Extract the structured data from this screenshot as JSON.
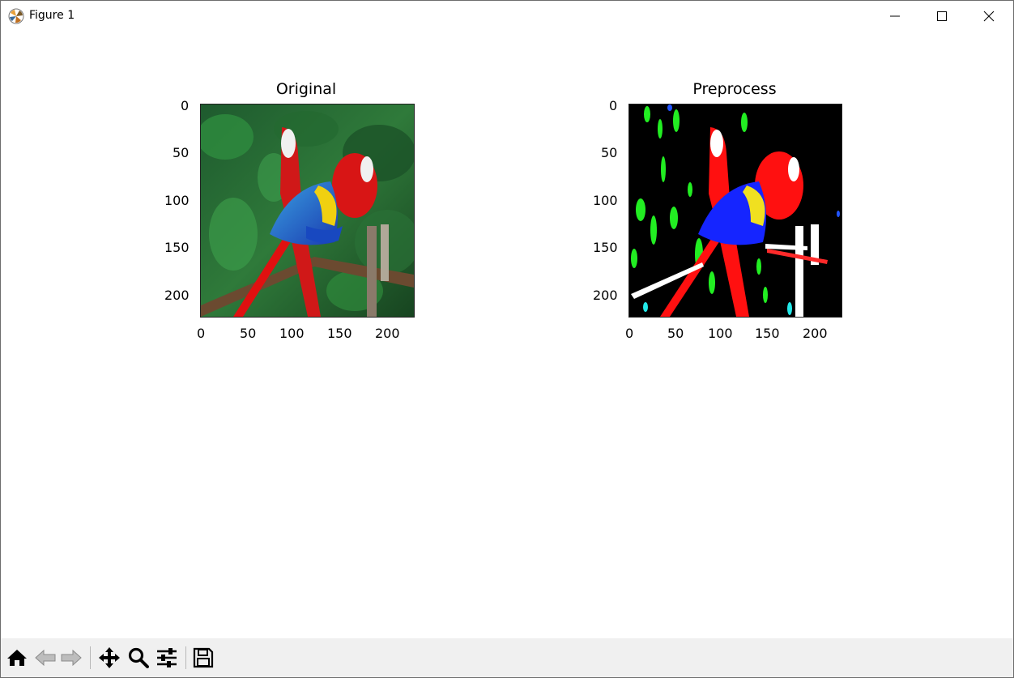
{
  "window": {
    "title": "Figure 1",
    "controls": {
      "minimize": "minimize-icon",
      "maximize": "maximize-icon",
      "close": "close-icon"
    }
  },
  "figure": {
    "axes": [
      {
        "title": "Original",
        "x_ticks": [
          "0",
          "50",
          "100",
          "150",
          "200"
        ],
        "y_ticks": [
          "0",
          "50",
          "100",
          "150",
          "200"
        ],
        "image": "parrots-photo"
      },
      {
        "title": "Preprocess",
        "x_ticks": [
          "0",
          "50",
          "100",
          "150",
          "200"
        ],
        "y_ticks": [
          "0",
          "50",
          "100",
          "150",
          "200"
        ],
        "image": "parrots-segmented"
      }
    ]
  },
  "toolbar": {
    "buttons": [
      "home-icon",
      "back-arrow-icon",
      "forward-arrow-icon",
      "pan-icon",
      "zoom-icon",
      "configure-subplots-icon",
      "save-icon"
    ]
  },
  "colors": {
    "toolbar_bg": "#f0f0f0",
    "window_bg": "#ffffff"
  }
}
